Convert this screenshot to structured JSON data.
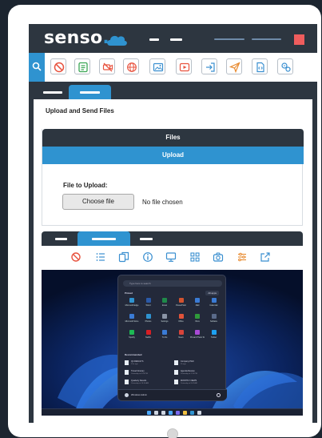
{
  "brand": {
    "name": "senso",
    "dot": ".",
    "accent": "#2f93d0",
    "dark": "#2d3640",
    "alert": "#ef5d5d"
  },
  "header": {
    "icons": [
      "cloud-icon",
      "menu-dash-icon",
      "menu-dash-icon",
      "menu-line-icon",
      "menu-line-icon",
      "close-square-icon"
    ]
  },
  "toolbar": {
    "icons": [
      "search-icon",
      "block-icon",
      "checklist-icon",
      "mute-video-icon",
      "globe-icon",
      "photo-icon",
      "video-icon",
      "login-icon",
      "send-icon",
      "file-code-icon",
      "settings-icon"
    ]
  },
  "main": {
    "section_title": "Upload and Send Files",
    "files_panel": {
      "header": "Files",
      "active_tab": "Upload",
      "file_label": "File to Upload:",
      "choose_button": "Choose file",
      "no_file_text": "No file chosen"
    }
  },
  "session": {
    "toolbar_icons": [
      "block-icon",
      "list-icon",
      "copy-icon",
      "info-icon",
      "monitor-icon",
      "grid-icon",
      "camera-icon",
      "sliders-icon",
      "external-link-icon"
    ],
    "desktop": {
      "search_placeholder": "Type here to search",
      "pinned_label": "Pinned",
      "all_apps_label": "All apps",
      "recommended_label": "Recommended",
      "user_name": "Windows Admin",
      "pinned_apps": [
        {
          "label": "Microsoft Edge",
          "color": "#2f93d0"
        },
        {
          "label": "Word",
          "color": "#2b5aa8"
        },
        {
          "label": "Excel",
          "color": "#1f8a4a"
        },
        {
          "label": "PowerPoint",
          "color": "#d2532f"
        },
        {
          "label": "Mail",
          "color": "#3a7bd5"
        },
        {
          "label": "Calendar",
          "color": "#3a7bd5"
        },
        {
          "label": "Microsoft Store",
          "color": "#3a7bd5"
        },
        {
          "label": "Photos",
          "color": "#2f93d0"
        },
        {
          "label": "Settings",
          "color": "#8a94a6"
        },
        {
          "label": "Office",
          "color": "#e0533a"
        },
        {
          "label": "Xbox",
          "color": "#2f9a3a"
        },
        {
          "label": "Solitaire",
          "color": "#5a6a8a"
        },
        {
          "label": "Spotify",
          "color": "#1db954"
        },
        {
          "label": "Netflix",
          "color": "#d81e24"
        },
        {
          "label": "To Do",
          "color": "#3a7bd5"
        },
        {
          "label": "News",
          "color": "#d8443a"
        },
        {
          "label": "Picsart Photo Studio",
          "color": "#a84ad5"
        },
        {
          "label": "Twitter",
          "color": "#1da1f2"
        }
      ],
      "recommended": [
        {
          "name": "Q4 RESULTS",
          "meta": "17m ago"
        },
        {
          "name": "Company Pitch",
          "meta": "2h ago"
        },
        {
          "name": "Travel Itinerary",
          "meta": "Yesterday at 4:24 PM"
        },
        {
          "name": "Agenda Review",
          "meta": "Yesterday at 1:15 PM"
        },
        {
          "name": "Quarterly Results",
          "meta": "Yesterday at 10:50 AM"
        },
        {
          "name": "MONTHLY NEWS",
          "meta": "Yesterday at 9:02 AM"
        }
      ],
      "taskbar_icons": [
        "windows-icon",
        "search-icon",
        "task-view-icon",
        "widgets-icon",
        "chat-icon",
        "explorer-icon",
        "edge-icon",
        "store-icon"
      ]
    }
  }
}
